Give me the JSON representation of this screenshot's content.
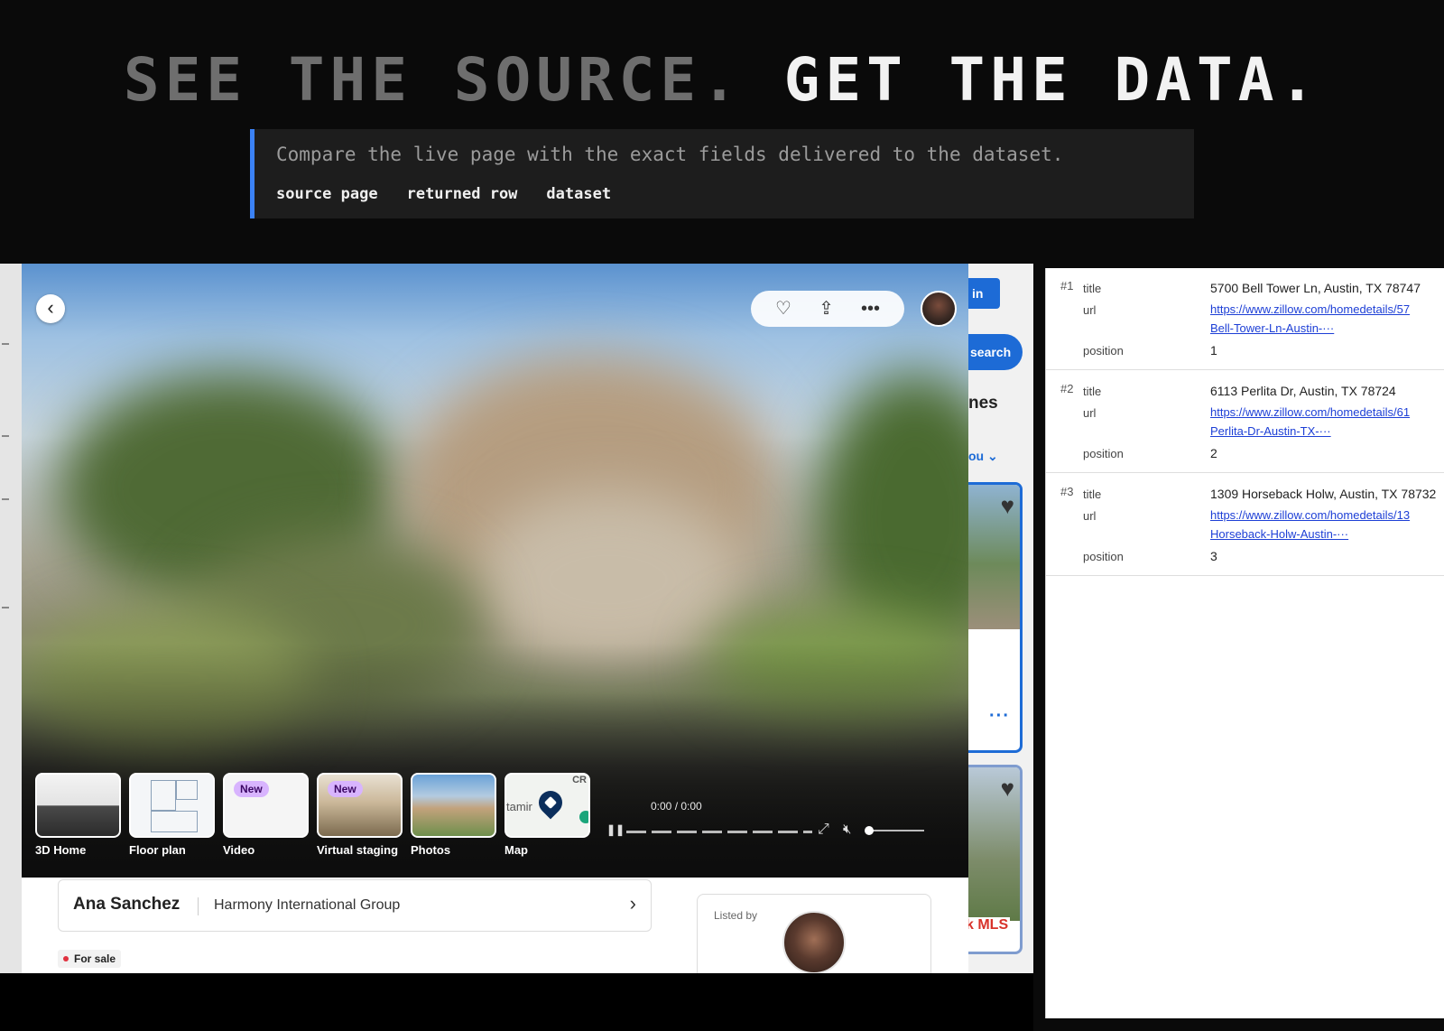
{
  "header": {
    "headline_dim": "SEE THE SOURCE.",
    "headline_bright": "GET THE DATA.",
    "description": "Compare the live page with the exact fields delivered to the dataset.",
    "chips": [
      "source page",
      "returned row",
      "dataset"
    ]
  },
  "source_page": {
    "partial": {
      "sign_in": "in",
      "search": "search",
      "homes": "nes",
      "for_you": "ou",
      "mls": "k MLS"
    },
    "media_tabs": [
      {
        "label": "3D Home",
        "badge": ""
      },
      {
        "label": "Floor plan",
        "badge": ""
      },
      {
        "label": "Video",
        "badge": "New"
      },
      {
        "label": "Virtual staging",
        "badge": "New"
      },
      {
        "label": "Photos",
        "badge": ""
      },
      {
        "label": "Map",
        "badge": ""
      }
    ],
    "map_thumb": {
      "road": "tamir",
      "corner": "CR"
    },
    "player": {
      "time": "0:00 / 0:00"
    },
    "agent": {
      "name": "Ana Sanchez",
      "company": "Harmony International Group"
    },
    "status": "For sale",
    "listed_by": "Listed by",
    "colors": {
      "accent": "#1d6bd6",
      "badge_bg": "#d8b4fe",
      "status_dot": "#e0313f"
    }
  },
  "dataset": {
    "keys": {
      "title": "title",
      "url": "url",
      "position": "position"
    },
    "rows": [
      {
        "index": "#1",
        "title": "5700 Bell Tower Ln, Austin, TX 78747",
        "url_line1": "https://www.zillow.com/homedetails/57",
        "url_line2": "Bell-Tower-Ln-Austin-···",
        "position": "1"
      },
      {
        "index": "#2",
        "title": "6113 Perlita Dr, Austin, TX 78724",
        "url_line1": "https://www.zillow.com/homedetails/61",
        "url_line2": "Perlita-Dr-Austin-TX-···",
        "position": "2"
      },
      {
        "index": "#3",
        "title": "1309 Horseback Holw, Austin, TX 78732",
        "url_line1": "https://www.zillow.com/homedetails/13",
        "url_line2": "Horseback-Holw-Austin-···",
        "position": "3"
      }
    ]
  }
}
